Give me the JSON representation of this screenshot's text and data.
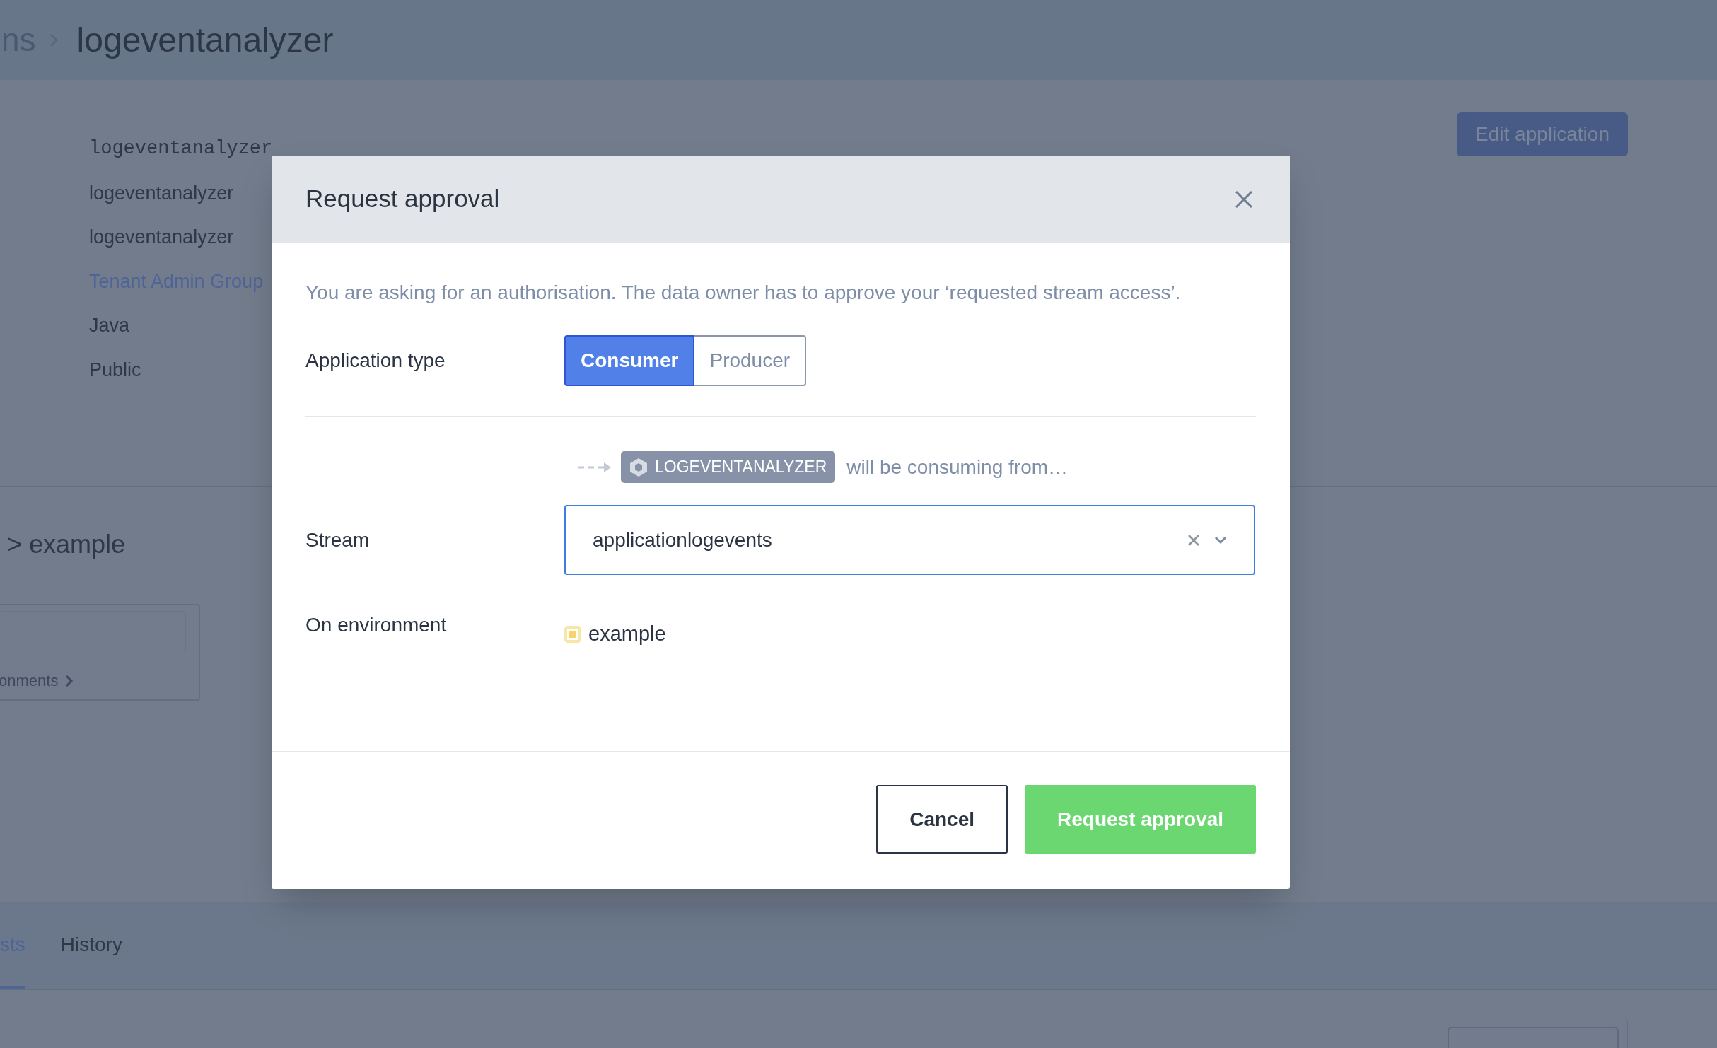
{
  "header": {
    "breadcrumb_parent": "ns",
    "title": "logeventanalyzer"
  },
  "edit_button": "Edit application",
  "details": [
    {
      "kind": "mono",
      "text": "logeventanalyzer"
    },
    {
      "kind": "plain",
      "text": "logeventanalyzer"
    },
    {
      "kind": "plain",
      "text": "logeventanalyzer"
    },
    {
      "kind": "link",
      "text": "Tenant Admin Group"
    },
    {
      "kind": "plain",
      "text": "Java"
    },
    {
      "kind": "plain",
      "text": "Public"
    }
  ],
  "section_title": "> example",
  "environments_link": "onments",
  "tabs": [
    {
      "label": "sts",
      "selected": true
    },
    {
      "label": "History",
      "selected": false
    }
  ],
  "modal": {
    "title": "Request approval",
    "description": "You are asking for an authorisation. The data owner has to approve your ‘requested stream access’.",
    "application_type": {
      "label": "Application type",
      "options": [
        {
          "label": "Consumer",
          "selected": true
        },
        {
          "label": "Producer",
          "selected": false
        }
      ]
    },
    "consumer_line": {
      "badge": "LOGEVENTANALYZER",
      "text": "will be consuming from…"
    },
    "stream": {
      "label": "Stream",
      "value": "applicationlogevents"
    },
    "environment": {
      "label": "On environment",
      "value": "example",
      "color": "#f5d46a"
    },
    "buttons": [
      {
        "label": "Cancel",
        "kind": "secondary"
      },
      {
        "label": "Request approval",
        "kind": "primary"
      }
    ]
  }
}
